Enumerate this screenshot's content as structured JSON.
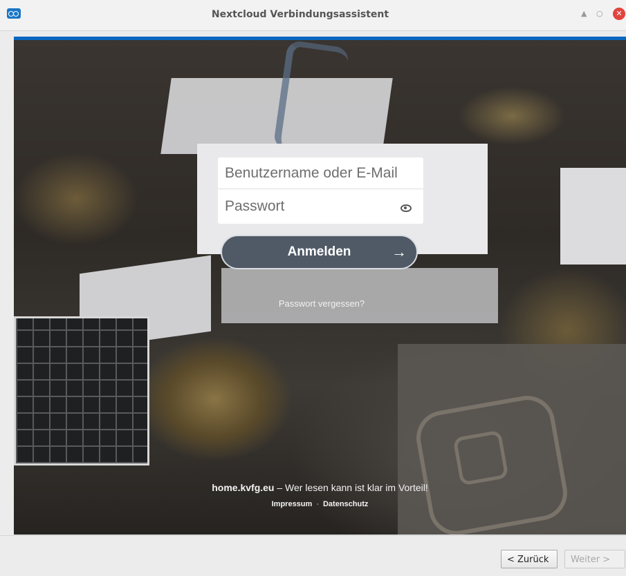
{
  "window": {
    "title": "Nextcloud Verbindungsassistent",
    "minimize_glyph": "▲",
    "maximize_glyph": "○",
    "close_glyph": "✕"
  },
  "login": {
    "username_placeholder": "Benutzername oder E-Mail",
    "password_placeholder": "Passwort",
    "submit_label": "Anmelden",
    "submit_arrow": "→",
    "forgot_password": "Passwort vergessen?"
  },
  "footer": {
    "site": "home.kvfg.eu",
    "slogan": " – Wer lesen kann ist klar im Vorteil!",
    "impressum": "Impressum",
    "separator": "·",
    "datenschutz": "Datenschutz"
  },
  "wizard": {
    "back_label": "< Zurück",
    "next_label": "Weiter >"
  },
  "colors": {
    "accent": "#0a68c2",
    "button": "#4f5a66",
    "close": "#e0443e"
  },
  "icons": [
    "nextcloud-app-icon",
    "eye-icon",
    "arrow-right-icon",
    "close-icon"
  ]
}
